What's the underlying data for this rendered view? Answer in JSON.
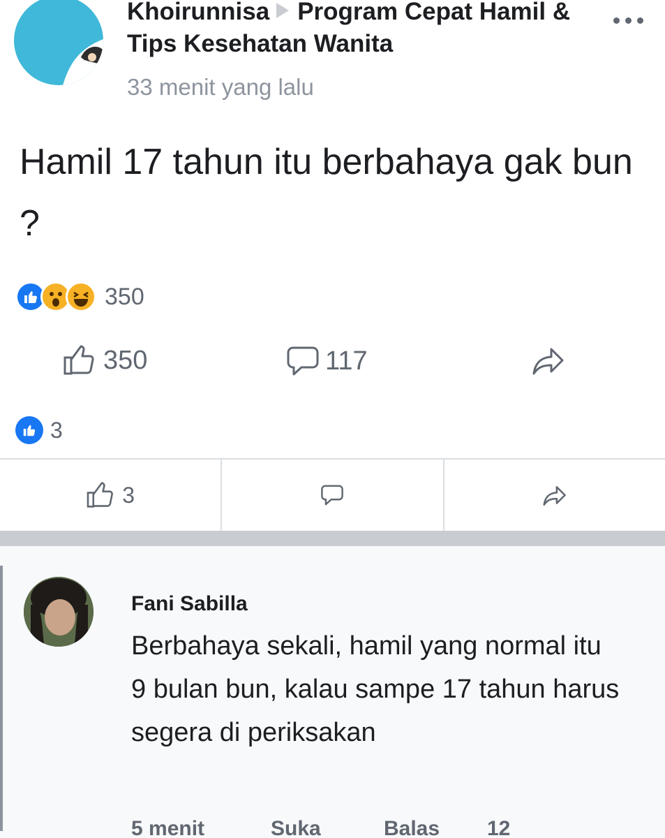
{
  "post": {
    "author": "Khoirunnisa",
    "group": "Program Cepat Hamil & Tips Kesehatan Wanita",
    "timestamp": "33 menit yang lalu",
    "text": "Hamil 17 tahun itu berbahaya gak bun ?",
    "reaction_total": "350",
    "reactions": [
      "like",
      "wow",
      "haha"
    ],
    "like_count": "350",
    "comment_count": "117",
    "more_icon": "more-dots-icon"
  },
  "subpost": {
    "like_badge_count": "3",
    "like_button_count": "3"
  },
  "comment": {
    "name": "Fani Sabilla",
    "text": "Berbahaya sekali, hamil yang normal itu 9 bulan bun, kalau sampe 17 tahun harus segera di periksakan",
    "time": "5 menit",
    "like_label": "Suka",
    "reply_label": "Balas",
    "reaction_count": "12"
  },
  "colors": {
    "like_blue": "#1877f2",
    "emoji_yellow": "#f7b125",
    "muted": "#606770"
  }
}
